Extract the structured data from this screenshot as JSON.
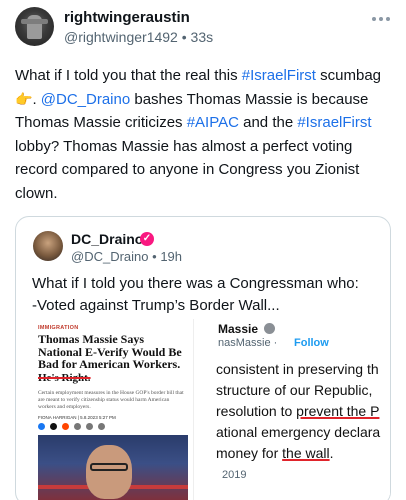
{
  "post": {
    "username": "rightwingeraustin",
    "handle": "@rightwinger1492",
    "separator": "•",
    "time": "33s",
    "body": {
      "t1": "What if I told you that the real this ",
      "tag1": "#IsraelFirst",
      "t2": " scumbag ",
      "emoji": "👉",
      "t3": ". ",
      "mention": "@DC_Draino",
      "t4": " bashes Thomas Massie is because Thomas Massie criticizes ",
      "tag2": "#AIPAC",
      "t5": " and the ",
      "tag3": "#IsraelFirst",
      "t6": " lobby? Thomas Massie has almost a perfect voting record compared to anyone in Congress you Zionist clown."
    }
  },
  "quote": {
    "name": "DC_Draino",
    "badge": "✓",
    "handle": "@DC_Draino",
    "separator": "•",
    "time": "19h",
    "line1": "What if I told you there was a Congressman who:",
    "line2": "-Voted against Trump’s Border Wall..."
  },
  "article": {
    "kicker": "IMMIGRATION",
    "headline": "Thomas Massie Says National E-Verify Would Be Bad for American Workers.",
    "struck": "He's Right.",
    "sub": "Certain employment measures in the House GOP's border bill that are meant to verify citizenship status would harm American workers and employers.",
    "byline": "FIONA HARRIGAN | 5.8.2023 5:27 PM"
  },
  "screenshot": {
    "name": "Massie",
    "handle": "nasMassie",
    "separator": "·",
    "follow": "Follow",
    "l1": "consistent in preserving th",
    "l2": "structure of our Republic,",
    "l3a": "resolution to ",
    "l3b": "prevent the P",
    "l4": "ational emergency declara",
    "l5a": "money for ",
    "l5b": "the wall",
    "l5c": ".",
    "date": "2019"
  },
  "colors": {
    "link": "#1d70e8",
    "secondary_text": "#536471",
    "verified_badge": "#f91880",
    "follow": "#1d9bf0",
    "underline_red": "#e0242b"
  },
  "icons": {
    "more": "more-horizontal-icon",
    "badge": "verified-badge-icon"
  }
}
